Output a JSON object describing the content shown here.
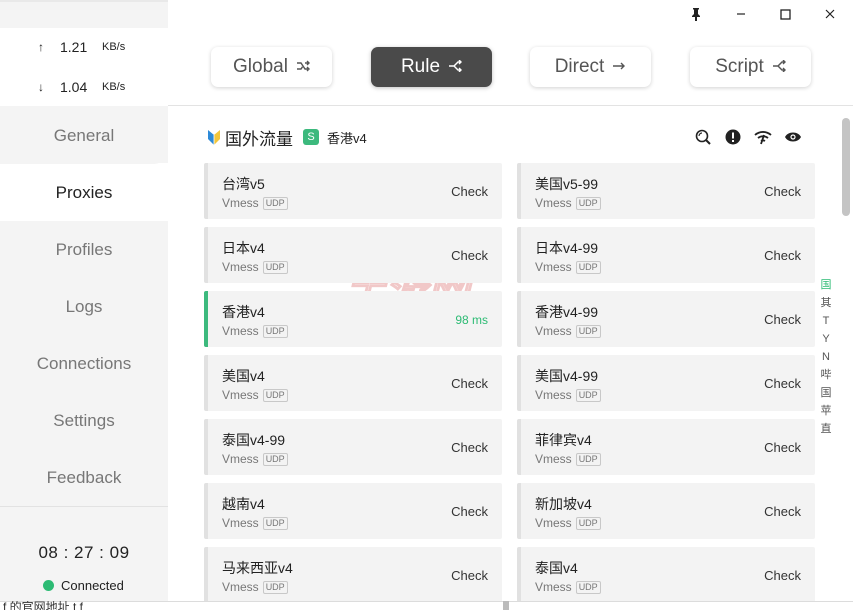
{
  "window": {
    "pin_glyph": "📌",
    "minimize_glyph": "—",
    "maximize_glyph": "☐",
    "close_glyph": "✕"
  },
  "traffic": {
    "up_arrow": "↑",
    "up_value": "1.21",
    "up_unit": "KB/s",
    "down_arrow": "↓",
    "down_value": "1.04",
    "down_unit": "KB/s"
  },
  "nav": {
    "general": "General",
    "proxies": "Proxies",
    "profiles": "Profiles",
    "logs": "Logs",
    "connections": "Connections",
    "settings": "Settings",
    "feedback": "Feedback"
  },
  "footer": {
    "time": "08 : 27 : 09",
    "status": "Connected",
    "status_color": "#2dbb74"
  },
  "modes": {
    "global": {
      "label": "Global",
      "icon": "⤳"
    },
    "rule": {
      "label": "Rule",
      "icon": "⊰"
    },
    "direct": {
      "label": "Direct",
      "icon": "→"
    },
    "script": {
      "label": "Script",
      "icon": "⊰"
    },
    "active": "Rule"
  },
  "group": {
    "name": "国外流量",
    "type_badge": "S",
    "selected": "香港v4"
  },
  "proxies": [
    {
      "name": "台湾v5",
      "type": "Vmess",
      "udp": "UDP",
      "action": "Check"
    },
    {
      "name": "美国v5-99",
      "type": "Vmess",
      "udp": "UDP",
      "action": "Check"
    },
    {
      "name": "日本v4",
      "type": "Vmess",
      "udp": "UDP",
      "action": "Check"
    },
    {
      "name": "日本v4-99",
      "type": "Vmess",
      "udp": "UDP",
      "action": "Check"
    },
    {
      "name": "香港v4",
      "type": "Vmess",
      "udp": "UDP",
      "action": "98 ms",
      "selected": true
    },
    {
      "name": "香港v4-99",
      "type": "Vmess",
      "udp": "UDP",
      "action": "Check"
    },
    {
      "name": "美国v4",
      "type": "Vmess",
      "udp": "UDP",
      "action": "Check"
    },
    {
      "name": "美国v4-99",
      "type": "Vmess",
      "udp": "UDP",
      "action": "Check"
    },
    {
      "name": "泰国v4-99",
      "type": "Vmess",
      "udp": "UDP",
      "action": "Check"
    },
    {
      "name": "菲律宾v4",
      "type": "Vmess",
      "udp": "UDP",
      "action": "Check"
    },
    {
      "name": "越南v4",
      "type": "Vmess",
      "udp": "UDP",
      "action": "Check"
    },
    {
      "name": "新加坡v4",
      "type": "Vmess",
      "udp": "UDP",
      "action": "Check"
    },
    {
      "name": "马来西亚v4",
      "type": "Vmess",
      "udp": "UDP",
      "action": "Check"
    },
    {
      "name": "泰国v4",
      "type": "Vmess",
      "udp": "UDP",
      "action": "Check"
    }
  ],
  "index_letters": [
    "国",
    "其",
    "T",
    "Y",
    "N",
    "哔",
    "国",
    "苹",
    "直"
  ],
  "watermark": {
    "line1": "手游网",
    "line2": "Gamedivert"
  },
  "bottom_text": "f    的官网地址                  t      f",
  "colors": {
    "accent": "#3cb97d",
    "active_mode_bg": "#4a4a4a",
    "sidebar_bg": "#f4f4f4"
  }
}
